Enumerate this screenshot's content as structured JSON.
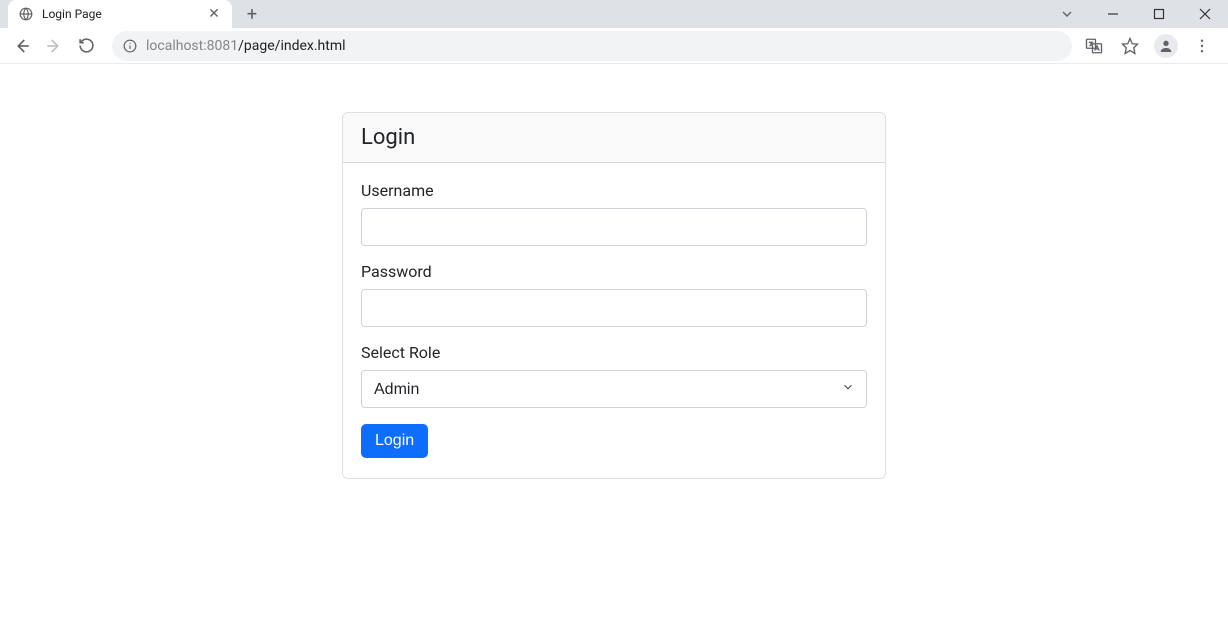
{
  "browser": {
    "tab_title": "Login Page",
    "url_host": "localhost:",
    "url_port": "8081",
    "url_path": "/page/index.html"
  },
  "card": {
    "title": "Login"
  },
  "form": {
    "username_label": "Username",
    "username_value": "",
    "password_label": "Password",
    "password_value": "",
    "role_label": "Select Role",
    "role_selected": "Admin",
    "login_button": "Login"
  }
}
